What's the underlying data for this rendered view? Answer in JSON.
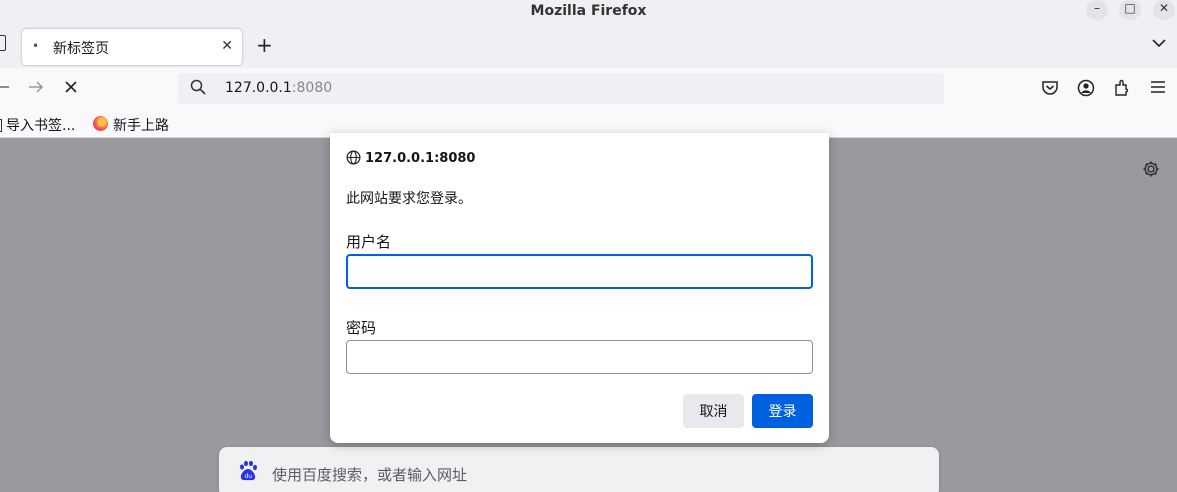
{
  "window": {
    "title": "Mozilla Firefox"
  },
  "tab": {
    "label": "新标签页"
  },
  "urlbar": {
    "host": "127.0.0.1",
    "port": ":8080"
  },
  "bookmarks": [
    {
      "label": "导入书签..."
    },
    {
      "label": "新手上路"
    }
  ],
  "newtab_search": {
    "placeholder": "使用百度搜索，或者输入网址"
  },
  "auth_dialog": {
    "origin": "127.0.0.1:8080",
    "message": "此网站要求您登录。",
    "username_label": "用户名",
    "username_value": "",
    "password_label": "密码",
    "password_value": "",
    "cancel_label": "取消",
    "login_label": "登录"
  },
  "colors": {
    "accent": "#0061e0",
    "overlay": "#9a999e"
  },
  "icons": [
    "minimize-icon",
    "maximize-icon",
    "close-icon",
    "back-icon",
    "forward-icon",
    "stop-icon",
    "search-icon",
    "pocket-icon",
    "account-icon",
    "extensions-icon",
    "menu-icon",
    "gear-icon",
    "globe-icon",
    "baidu-icon",
    "firefox-icon"
  ]
}
